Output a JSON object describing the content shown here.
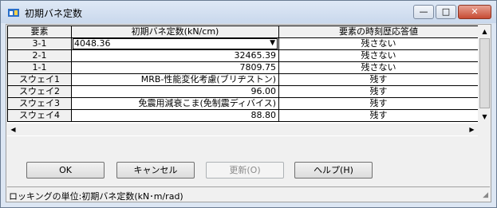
{
  "window": {
    "title": "初期バネ定数",
    "min_glyph": "—",
    "max_glyph": "□",
    "close_glyph": "✕"
  },
  "grid": {
    "columns": [
      "要素",
      "初期バネ定数(kN/cm)",
      "要素の時刻歴応答値"
    ],
    "rows": [
      {
        "element": "3-1",
        "value": "4048.36",
        "response": "残さない",
        "editing": true
      },
      {
        "element": "2-1",
        "value": "32465.39",
        "response": "残さない"
      },
      {
        "element": "1-1",
        "value": "7809.75",
        "response": "残さない"
      },
      {
        "element": "スウェイ1",
        "value": "MRB-性能変化考慮(ブリヂストン)",
        "response": "残す"
      },
      {
        "element": "スウェイ2",
        "value": "96.00",
        "response": "残す"
      },
      {
        "element": "スウェイ3",
        "value": "免震用減衰こま(免制震ディバイス)",
        "response": "残す"
      },
      {
        "element": "スウェイ4",
        "value": "88.80",
        "response": "残す"
      }
    ],
    "dropdown_glyph": "▼"
  },
  "scroll": {
    "up": "▲",
    "down": "▼",
    "left": "◀",
    "right": "▶"
  },
  "buttons": {
    "ok": "OK",
    "cancel": "キャンセル",
    "update": "更新(O)",
    "help": "ヘルプ(H)"
  },
  "status": "ロッキングの単位:初期バネ定数(kN･m/rad)",
  "grip": "◢"
}
